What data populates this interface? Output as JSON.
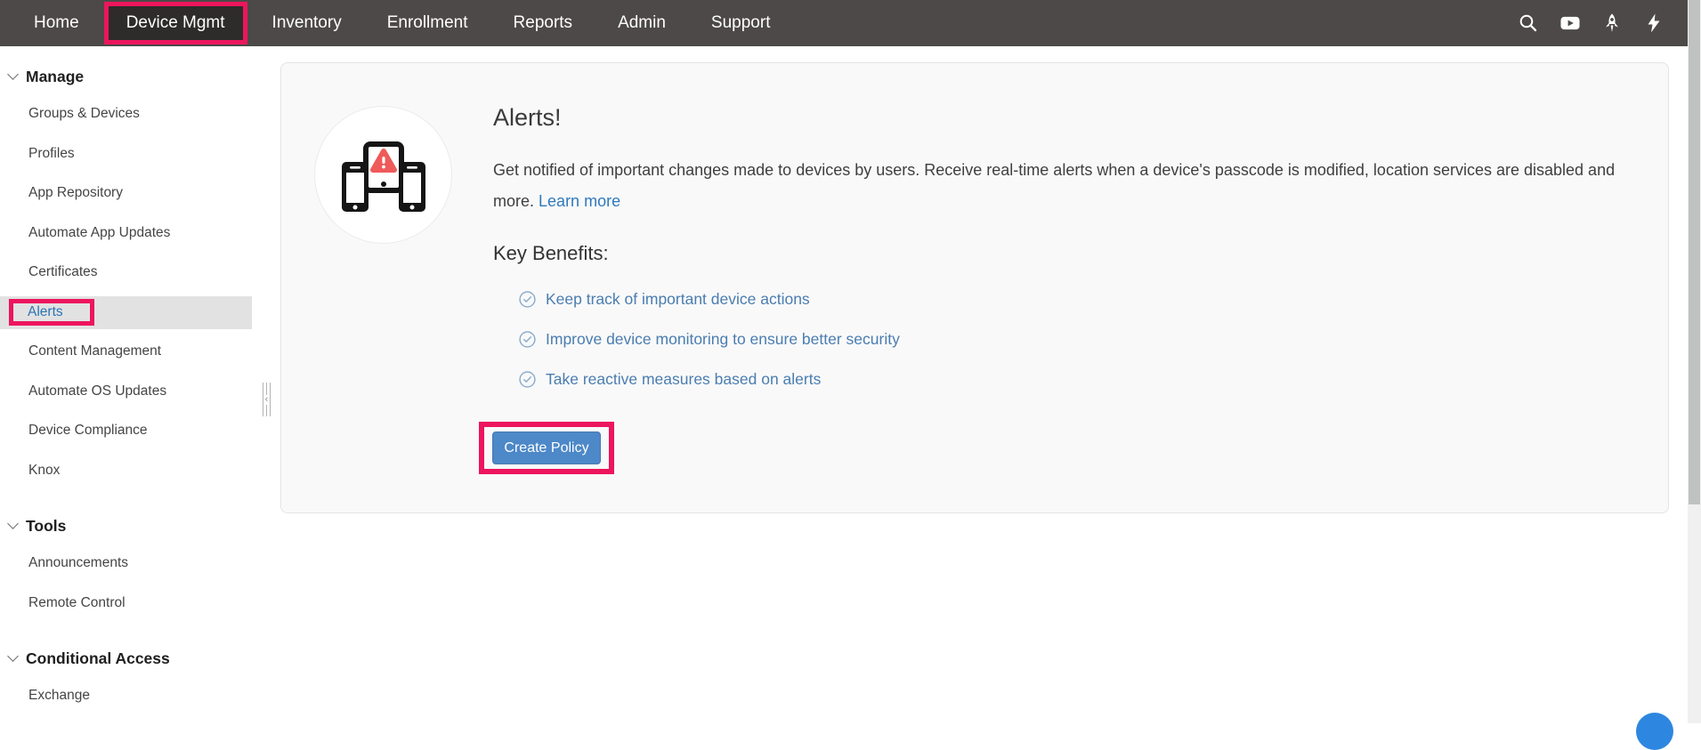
{
  "nav": {
    "items": [
      "Home",
      "Device Mgmt",
      "Inventory",
      "Enrollment",
      "Reports",
      "Admin",
      "Support"
    ],
    "active_item": "Device Mgmt",
    "icons": [
      "search-icon",
      "video-tutorials-icon",
      "rocket-icon",
      "quick-actions-bolt-icon"
    ]
  },
  "sidebar": {
    "sections": [
      {
        "label": "Manage",
        "items": [
          "Groups & Devices",
          "Profiles",
          "App Repository",
          "Automate App Updates",
          "Certificates",
          "Alerts",
          "Content Management",
          "Automate OS Updates",
          "Device Compliance",
          "Knox"
        ]
      },
      {
        "label": "Tools",
        "items": [
          "Announcements",
          "Remote Control"
        ]
      },
      {
        "label": "Conditional Access",
        "items": [
          "Exchange"
        ]
      }
    ],
    "selected_item": "Alerts"
  },
  "main": {
    "title": "Alerts!",
    "description": "Get notified of important changes made to devices by users. Receive real-time alerts when a device's passcode is modified, location services are disabled and more.",
    "learn_more_label": "Learn more",
    "benefits_title": "Key Benefits:",
    "benefits": [
      "Keep track of important device actions",
      "Improve device monitoring to ensure better security",
      "Take reactive measures based on alerts"
    ],
    "create_policy_label": "Create Policy"
  },
  "colors": {
    "navbar_bg": "#4C4948",
    "active_tab_bg": "#2E2B2B",
    "annotation_red": "#ED155E",
    "selected_row_gray": "#E2E2E2",
    "sidebar_selected_text_blue": "#2B73B4",
    "link_blue": "#2E79BD",
    "benefit_blue": "#4A7DB0",
    "button_blue": "#4D88C8",
    "alert_triangle_red": "#EF5A5A",
    "scrollbar_thumb": "#C0C2C2",
    "fab_blue": "#2D87E0",
    "card_bg": "#F9F9F9"
  }
}
